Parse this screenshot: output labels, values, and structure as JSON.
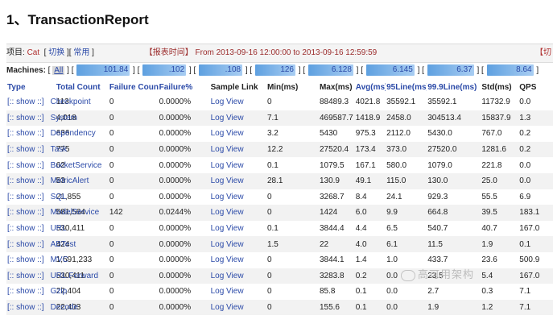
{
  "page": {
    "heading": "1、TransactionReport"
  },
  "meta": {
    "project_label": "项目:",
    "project": "Cat",
    "switch_link": "切换",
    "common_link": "常用",
    "report_time_label": "【报表时间】",
    "time_range": "From 2013-09-16 12:00:00 to 2013-09-16 12:59:59",
    "right_fragment": "【切"
  },
  "machines": {
    "label": "Machines:",
    "all": "All",
    "list": [
      "101.84",
      ".102",
      ".108",
      "126",
      "6.128",
      "6.145",
      "6.37",
      "8.64"
    ]
  },
  "table": {
    "headers": [
      "Type",
      "Total Count",
      "Failure Count",
      "Failure%",
      "Sample Link",
      "Min(ms)",
      "Max(ms)",
      "Avg(ms)",
      "95Line(ms)",
      "99.9Line(ms)",
      "Std(ms)",
      "QPS"
    ],
    "show_label": "[:: show ::]",
    "log_label": "Log View",
    "rows": [
      {
        "type": "Checkpoint",
        "total": "113",
        "fail": "0",
        "failpct": "0.0000%",
        "min": "0",
        "max": "88489.3",
        "avg": "4021.8",
        "p95": "35592.1",
        "p999": "35592.1",
        "std": "11732.9",
        "qps": "0.0"
      },
      {
        "type": "System",
        "total": "4,018",
        "fail": "0",
        "failpct": "0.0000%",
        "min": "7.1",
        "max": "469587.7",
        "avg": "1418.9",
        "p95": "2458.0",
        "p999": "304513.4",
        "std": "15837.9",
        "qps": "1.3"
      },
      {
        "type": "Dependency",
        "total": "636",
        "fail": "0",
        "failpct": "0.0000%",
        "min": "3.2",
        "max": "5430",
        "avg": "975.3",
        "p95": "2112.0",
        "p999": "5430.0",
        "std": "767.0",
        "qps": "0.2"
      },
      {
        "type": "Task",
        "total": "775",
        "fail": "0",
        "failpct": "0.0000%",
        "min": "12.2",
        "max": "27520.4",
        "avg": "173.4",
        "p95": "373.0",
        "p999": "27520.0",
        "std": "1281.6",
        "qps": "0.2"
      },
      {
        "type": "BucketService",
        "total": "62",
        "fail": "0",
        "failpct": "0.0000%",
        "min": "0.1",
        "max": "1079.5",
        "avg": "167.1",
        "p95": "580.0",
        "p999": "1079.0",
        "std": "221.8",
        "qps": "0.0"
      },
      {
        "type": "MetricAlert",
        "total": "53",
        "fail": "0",
        "failpct": "0.0000%",
        "min": "28.1",
        "max": "130.9",
        "avg": "49.1",
        "p95": "115.0",
        "p999": "130.0",
        "std": "25.0",
        "qps": "0.0"
      },
      {
        "type": "SQL",
        "total": "21,855",
        "fail": "0",
        "failpct": "0.0000%",
        "min": "0",
        "max": "3268.7",
        "avg": "8.4",
        "p95": "24.1",
        "p999": "929.3",
        "std": "55.5",
        "qps": "6.9"
      },
      {
        "type": "ModelService",
        "total": "581,564",
        "fail": "142",
        "failpct": "0.0244%",
        "min": "0",
        "max": "1424",
        "avg": "6.0",
        "p95": "9.9",
        "p999": "664.8",
        "std": "39.5",
        "qps": "183.1"
      },
      {
        "type": "URL",
        "total": "530,411",
        "fail": "0",
        "failpct": "0.0000%",
        "min": "0.1",
        "max": "3844.4",
        "avg": "4.4",
        "p95": "6.5",
        "p999": "540.7",
        "std": "40.7",
        "qps": "167.0"
      },
      {
        "type": "ABTest",
        "total": "424",
        "fail": "0",
        "failpct": "0.0000%",
        "min": "1.5",
        "max": "22",
        "avg": "4.0",
        "p95": "6.1",
        "p999": "11.5",
        "std": "1.9",
        "qps": "0.1"
      },
      {
        "type": "MVC",
        "total": "1,591,233",
        "fail": "0",
        "failpct": "0.0000%",
        "min": "0",
        "max": "3844.1",
        "avg": "1.4",
        "p95": "1.0",
        "p999": "433.7",
        "std": "23.6",
        "qps": "500.9"
      },
      {
        "type": "URL.Forward",
        "total": "530,411",
        "fail": "0",
        "failpct": "0.0000%",
        "min": "0",
        "max": "3283.8",
        "avg": "0.2",
        "p95": "0.0",
        "p999": "23.5",
        "std": "5.4",
        "qps": "167.0"
      },
      {
        "type": "Gzip",
        "total": "22,404",
        "fail": "0",
        "failpct": "0.0000%",
        "min": "0",
        "max": "85.8",
        "avg": "0.1",
        "p95": "0.0",
        "p999": "2.7",
        "std": "0.3",
        "qps": "7.1"
      },
      {
        "type": "Decode",
        "total": "22,403",
        "fail": "0",
        "failpct": "0.0000%",
        "min": "0",
        "max": "155.6",
        "avg": "0.1",
        "p95": "0.0",
        "p999": "1.9",
        "std": "1.2",
        "qps": "7.1"
      }
    ]
  },
  "watermark": "高可用架构"
}
